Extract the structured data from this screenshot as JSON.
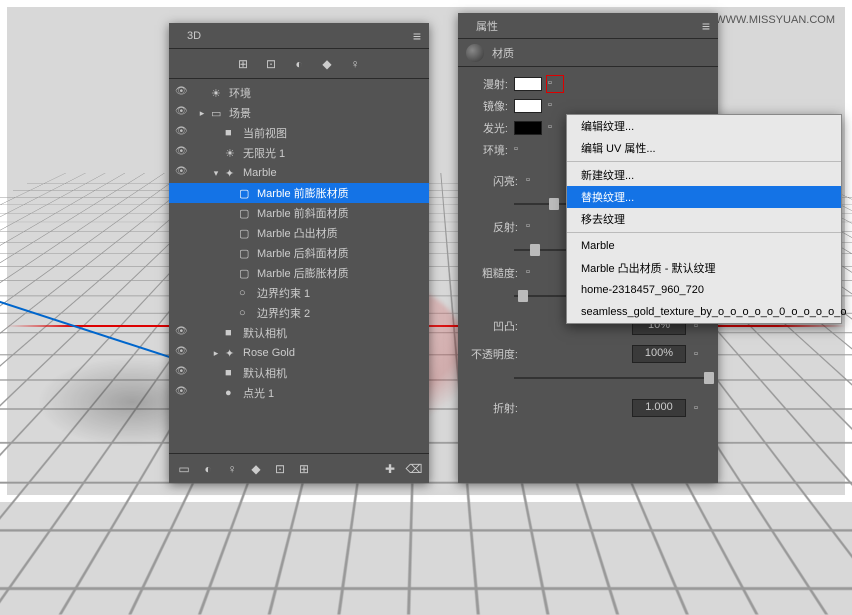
{
  "watermark": "思缘设计论坛 WWW.MISSYUAN.COM",
  "panel3d": {
    "title": "3D",
    "toolbar": [
      "⊞",
      "⊡",
      "◐",
      "◆",
      "♀"
    ],
    "tree": [
      {
        "eye": "👁",
        "indent": 0,
        "tw": "",
        "ic": "☀",
        "label": "环境",
        "sel": false
      },
      {
        "eye": "👁",
        "indent": 0,
        "tw": "▸",
        "ic": "▭",
        "label": "场景",
        "sel": false
      },
      {
        "eye": "👁",
        "indent": 1,
        "tw": "",
        "ic": "■",
        "label": "当前视图",
        "sel": false
      },
      {
        "eye": "👁",
        "indent": 1,
        "tw": "",
        "ic": "☀",
        "label": "无限光 1",
        "sel": false
      },
      {
        "eye": "👁",
        "indent": 1,
        "tw": "▾",
        "ic": "✦",
        "label": "Marble",
        "sel": false
      },
      {
        "eye": "",
        "indent": 2,
        "tw": "",
        "ic": "▢",
        "label": "Marble 前膨胀材质",
        "sel": true
      },
      {
        "eye": "",
        "indent": 2,
        "tw": "",
        "ic": "▢",
        "label": "Marble 前斜面材质",
        "sel": false
      },
      {
        "eye": "",
        "indent": 2,
        "tw": "",
        "ic": "▢",
        "label": "Marble 凸出材质",
        "sel": false
      },
      {
        "eye": "",
        "indent": 2,
        "tw": "",
        "ic": "▢",
        "label": "Marble 后斜面材质",
        "sel": false
      },
      {
        "eye": "",
        "indent": 2,
        "tw": "",
        "ic": "▢",
        "label": "Marble 后膨胀材质",
        "sel": false
      },
      {
        "eye": "",
        "indent": 2,
        "tw": "",
        "ic": "○",
        "label": "边界约束 1",
        "sel": false
      },
      {
        "eye": "",
        "indent": 2,
        "tw": "",
        "ic": "○",
        "label": "边界约束 2",
        "sel": false
      },
      {
        "eye": "👁",
        "indent": 1,
        "tw": "",
        "ic": "■",
        "label": "默认相机",
        "sel": false
      },
      {
        "eye": "👁",
        "indent": 1,
        "tw": "▸",
        "ic": "✦",
        "label": "Rose Gold",
        "sel": false
      },
      {
        "eye": "👁",
        "indent": 1,
        "tw": "",
        "ic": "■",
        "label": "默认相机",
        "sel": false
      },
      {
        "eye": "👁",
        "indent": 1,
        "tw": "",
        "ic": "●",
        "label": "点光 1",
        "sel": false
      }
    ],
    "footer_icons": [
      "▭",
      "◐",
      "♀",
      "◆",
      "⊡",
      "⊞",
      "✚",
      "⌫"
    ]
  },
  "panelProp": {
    "title": "属性",
    "subtitle": "材质",
    "maps": [
      {
        "lbl": "漫射:",
        "sw": "light",
        "docRed": true
      },
      {
        "lbl": "镜像:",
        "sw": "light",
        "docRed": false
      },
      {
        "lbl": "发光:",
        "sw": "dark",
        "docRed": false
      }
    ],
    "envLabel": "环境:",
    "sliders": [
      {
        "lbl": "闪亮:",
        "pos": 18
      },
      {
        "lbl": "反射:",
        "pos": 8
      },
      {
        "lbl": "粗糙度:",
        "pos": 2
      }
    ],
    "valueRows": [
      {
        "lbl": "凹凸:",
        "val": "10%"
      },
      {
        "lbl": "不透明度:",
        "val": "100%"
      },
      {
        "lbl": "折射:",
        "val": "1.000"
      }
    ],
    "opacityThumb": 98
  },
  "ctx": {
    "items": [
      {
        "label": "编辑纹理...",
        "sel": false
      },
      {
        "label": "编辑 UV 属性...",
        "sel": false
      },
      {
        "sep": true
      },
      {
        "label": "新建纹理...",
        "sel": false
      },
      {
        "label": "替换纹理...",
        "sel": true
      },
      {
        "label": "移去纹理",
        "sel": false
      },
      {
        "sep": true
      },
      {
        "label": "Marble",
        "sel": false
      },
      {
        "label": "Marble 凸出材质 - 默认纹理",
        "sel": false
      },
      {
        "label": "home-2318457_960_720",
        "sel": false
      },
      {
        "label": "seamless_gold_texture_by_o_o_o_o_o_0_o_o_o_o_o",
        "sel": false
      }
    ]
  }
}
